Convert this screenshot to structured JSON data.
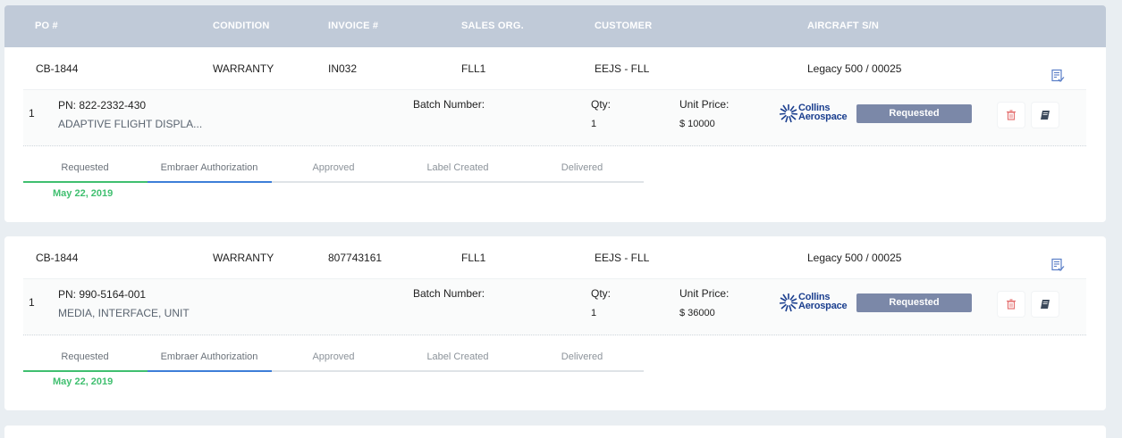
{
  "header": {
    "po": "PO #",
    "condition": "CONDITION",
    "invoice": "INVOICE #",
    "sales_org": "SALES ORG.",
    "customer": "CUSTOMER",
    "aircraft": "AIRCRAFT S/N"
  },
  "orders": [
    {
      "po": "CB-1844",
      "condition": "WARRANTY",
      "invoice": "IN032",
      "sales_org": "FLL1",
      "customer": "EEJS - FLL",
      "aircraft": "Legacy 500 / 00025",
      "line": {
        "index": "1",
        "pn": "PN: 822-2332-430",
        "description": "ADAPTIVE FLIGHT DISPLA...",
        "batch_label": "Batch Number:",
        "qty_label": "Qty:",
        "qty": "1",
        "unit_price_label": "Unit Price:",
        "unit_price": "$ 10000",
        "vendor_line1": "Collins",
        "vendor_line2": "Aerospace",
        "status": "Requested"
      },
      "steps": [
        "Requested",
        "Embraer Authorization",
        "Approved",
        "Label Created",
        "Delivered"
      ],
      "step_date": "May 22, 2019"
    },
    {
      "po": "CB-1844",
      "condition": "WARRANTY",
      "invoice": "807743161",
      "sales_org": "FLL1",
      "customer": "EEJS - FLL",
      "aircraft": "Legacy 500 / 00025",
      "line": {
        "index": "1",
        "pn": "PN: 990-5164-001",
        "description": "MEDIA, INTERFACE, UNIT",
        "batch_label": "Batch Number:",
        "qty_label": "Qty:",
        "qty": "1",
        "unit_price_label": "Unit Price:",
        "unit_price": "$ 36000",
        "vendor_line1": "Collins",
        "vendor_line2": "Aerospace",
        "status": "Requested"
      },
      "steps": [
        "Requested",
        "Embraer Authorization",
        "Approved",
        "Label Created",
        "Delivered"
      ],
      "step_date": "May 22, 2019"
    }
  ],
  "colors": {
    "header_bg": "#c0cad8",
    "status_badge": "#7b88a8",
    "step_done": "#3fbf6f",
    "step_current": "#3d7ed8",
    "delete_icon": "#e57373"
  },
  "icons": {
    "notes": "notes-check-icon",
    "delete": "trash-icon",
    "book": "book-icon",
    "vendor_logo": "collins-aerospace-logo"
  }
}
